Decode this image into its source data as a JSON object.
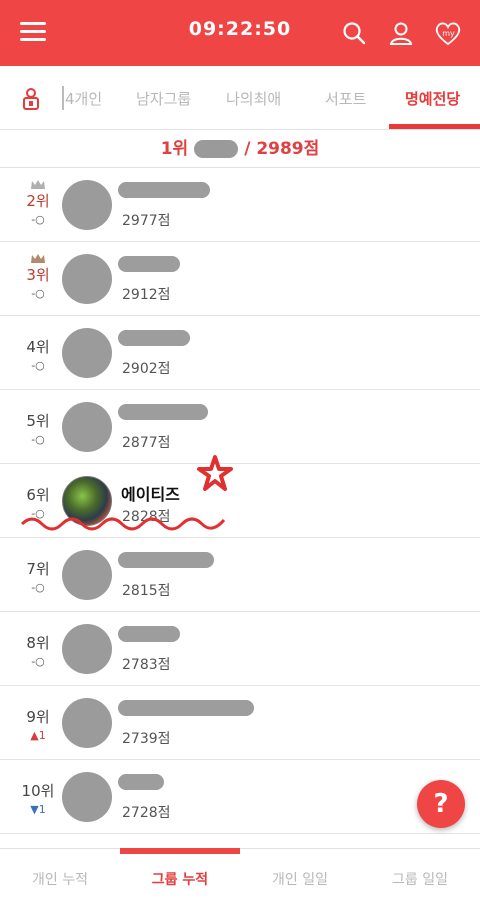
{
  "header": {
    "time": "09:22:50",
    "my_label": "my"
  },
  "tabs": [
    {
      "label": "4개인"
    },
    {
      "label": "남자그룹"
    },
    {
      "label": "나의최애"
    },
    {
      "label": "서포트"
    },
    {
      "label": "명예전당"
    }
  ],
  "banner": {
    "rank": "1위",
    "score_text": "/ 2989점"
  },
  "rows": [
    {
      "rank": "2위",
      "change": "-○",
      "score": "2977점",
      "name": ""
    },
    {
      "rank": "3위",
      "change": "-○",
      "score": "2912점",
      "name": ""
    },
    {
      "rank": "4위",
      "change": "-○",
      "score": "2902점",
      "name": ""
    },
    {
      "rank": "5위",
      "change": "-○",
      "score": "2877점",
      "name": ""
    },
    {
      "rank": "6위",
      "change": "-○",
      "score": "2828점",
      "name": "에이티즈"
    },
    {
      "rank": "7위",
      "change": "-○",
      "score": "2815점",
      "name": ""
    },
    {
      "rank": "8위",
      "change": "-○",
      "score": "2783점",
      "name": ""
    },
    {
      "rank": "9위",
      "change": "▲1",
      "score": "2739점",
      "name": ""
    },
    {
      "rank": "10위",
      "change": "▼1",
      "score": "2728점",
      "name": ""
    }
  ],
  "help": {
    "label": "?"
  },
  "bottom_nav": [
    {
      "label": "개인 누적"
    },
    {
      "label": "그룹 누적"
    },
    {
      "label": "개인 일일"
    },
    {
      "label": "그룹 일일"
    }
  ],
  "colors": {
    "brand": "#f04545",
    "accent_text": "#e83a3a"
  },
  "icons": {
    "menu": "hamburger-icon",
    "search": "search-icon",
    "profile": "user-icon",
    "my": "heart-my-icon",
    "crown": "crown-icon",
    "star": "star-doodle"
  }
}
